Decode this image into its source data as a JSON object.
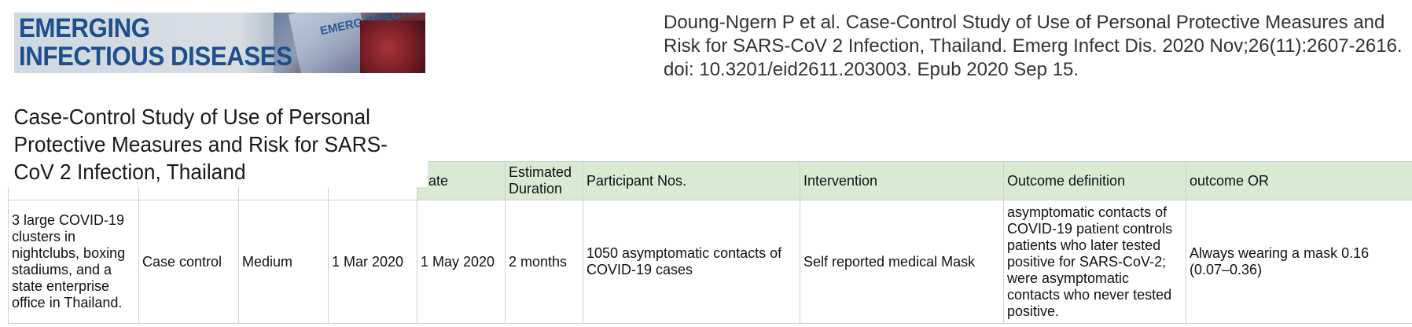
{
  "banner": {
    "line1": "EMERGING",
    "line2": "INFECTIOUS DISEASES",
    "registered": "®",
    "cover_text": "EMERG INFECTIO"
  },
  "citation": "Doung-Ngern P et al. Case-Control Study of Use of Personal Protective Measures and Risk for SARS-CoV 2 Infection, Thailand. Emerg Infect Dis. 2020 Nov;26(11):2607-2616. doi: 10.3201/eid2611.203003. Epub 2020 Sep 15.",
  "title": "Case-Control Study of Use of Personal Protective Measures and Risk for SARS-CoV 2 Infection, Thailand",
  "table": {
    "headers": [
      "",
      "",
      "",
      "",
      "date",
      "Estimated Duration",
      "Participant Nos.",
      "Intervention",
      "Outcome definition",
      "outcome OR"
    ],
    "row": {
      "setting": "3 large COVID-19 clusters in nightclubs, boxing stadiums, and a state enterprise office in Thailand.",
      "design": "Case control",
      "quality": "Medium",
      "start_date": "1 Mar 2020",
      "end_date": "1 May 2020",
      "duration": "2 months",
      "participants": "1050 asymptomatic contacts of COVID-19 cases",
      "intervention": "Self reported medical Mask",
      "outcome_definition": "asymptomatic contacts of COVID-19 patient  controls patients who later tested positive for SARS-CoV-2; were asymptomatic contacts who never tested positive.",
      "outcome_or": "Always wearing a mask 0.16 (0.07–0.36)"
    }
  }
}
